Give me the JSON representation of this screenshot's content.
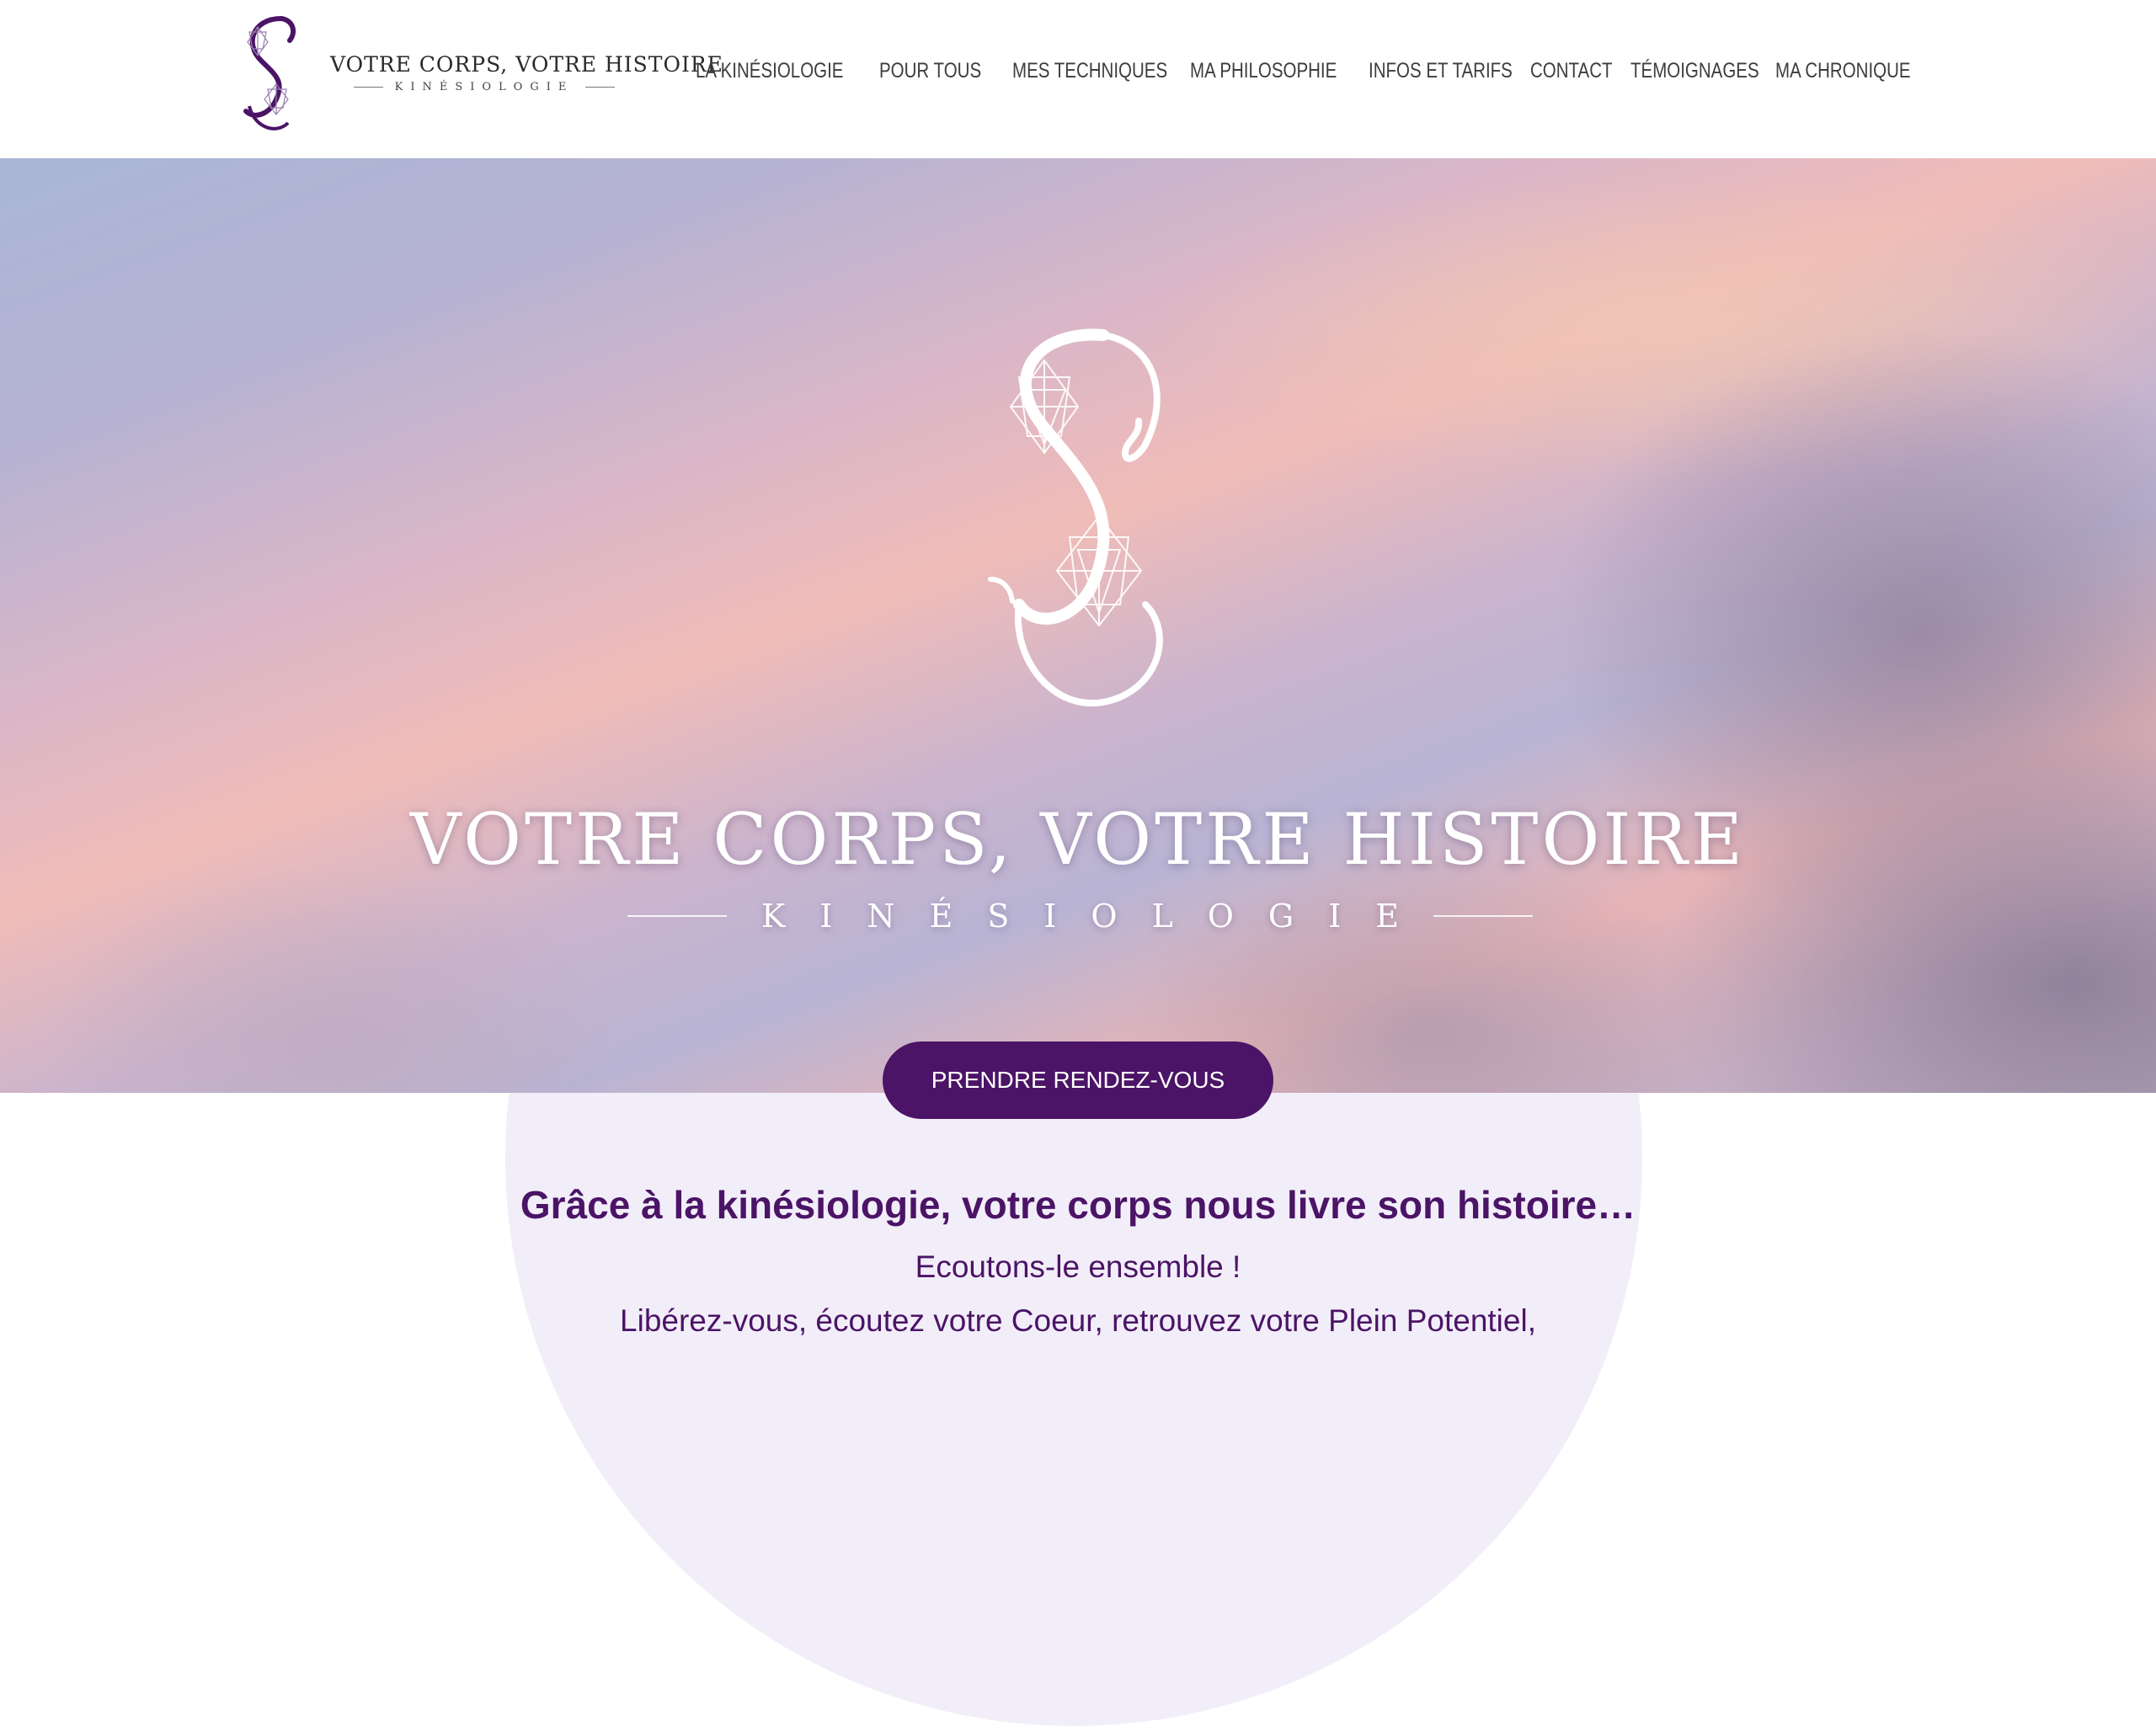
{
  "header": {
    "brand_title": "VOTRE CORPS, VOTRE HISTOIRE",
    "brand_subtitle": "KINÉSIOLOGIE",
    "nav": [
      {
        "label": "LA KINÉSIOLOGIE"
      },
      {
        "label": "POUR TOUS"
      },
      {
        "label": "MES TECHNIQUES"
      },
      {
        "label": "MA PHILOSOPHIE"
      },
      {
        "label": "INFOS ET TARIFS"
      },
      {
        "label": "CONTACT"
      },
      {
        "label": "TÉMOIGNAGES"
      },
      {
        "label": "MA CHRONIQUE"
      }
    ]
  },
  "hero": {
    "title": "VOTRE CORPS, VOTRE HISTOIRE",
    "subtitle": "KINÉSIOLOGIE",
    "cta_label": "PRENDRE RENDEZ-VOUS"
  },
  "intro": {
    "tagline": "Grâce à la kinésiologie, votre corps nous livre son histoire…",
    "line2": "Ecoutons-le ensemble !",
    "line3": "Libérez-vous, écoutez votre Coeur, retrouvez votre Plein Potentiel,"
  },
  "colors": {
    "brand_purple": "#4b1466",
    "nav_text": "#3d3d3d",
    "circle": "#f2eef9"
  },
  "icons": {
    "logo": "swirl-star-emblem"
  }
}
